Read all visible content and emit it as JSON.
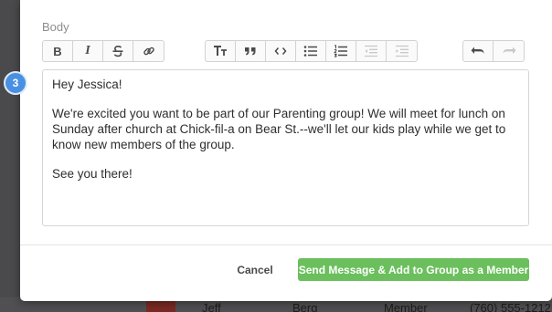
{
  "modal": {
    "field_label": "Body",
    "step_number": "3",
    "toolbar": {
      "bold_label": "B",
      "italic_label": "I",
      "heading_label": "T",
      "icons": [
        "bold-icon",
        "italic-icon",
        "strikethrough-icon",
        "link-icon",
        "text-size-icon",
        "quote-icon",
        "code-icon",
        "bullet-list-icon",
        "numbered-list-icon",
        "outdent-icon",
        "indent-icon",
        "undo-icon",
        "redo-icon"
      ]
    },
    "body": {
      "greeting": "Hey Jessica!",
      "paragraph": "We're excited you want to be part of our Parenting group! We will meet for lunch on Sunday after church at Chick-fil-a on Bear St.--we'll let our kids play while we get to know new members of the group.",
      "closing": "See you there!"
    },
    "footer": {
      "cancel_label": "Cancel",
      "submit_label": "Send Message & Add to Group as a Member"
    },
    "colors": {
      "primary": "#6bbf5d",
      "badge": "#4a90e2"
    }
  },
  "background_row": {
    "first_name": "Jeff",
    "last_name": "Berg",
    "role": "Member",
    "phone": "(760) 555-1212"
  }
}
